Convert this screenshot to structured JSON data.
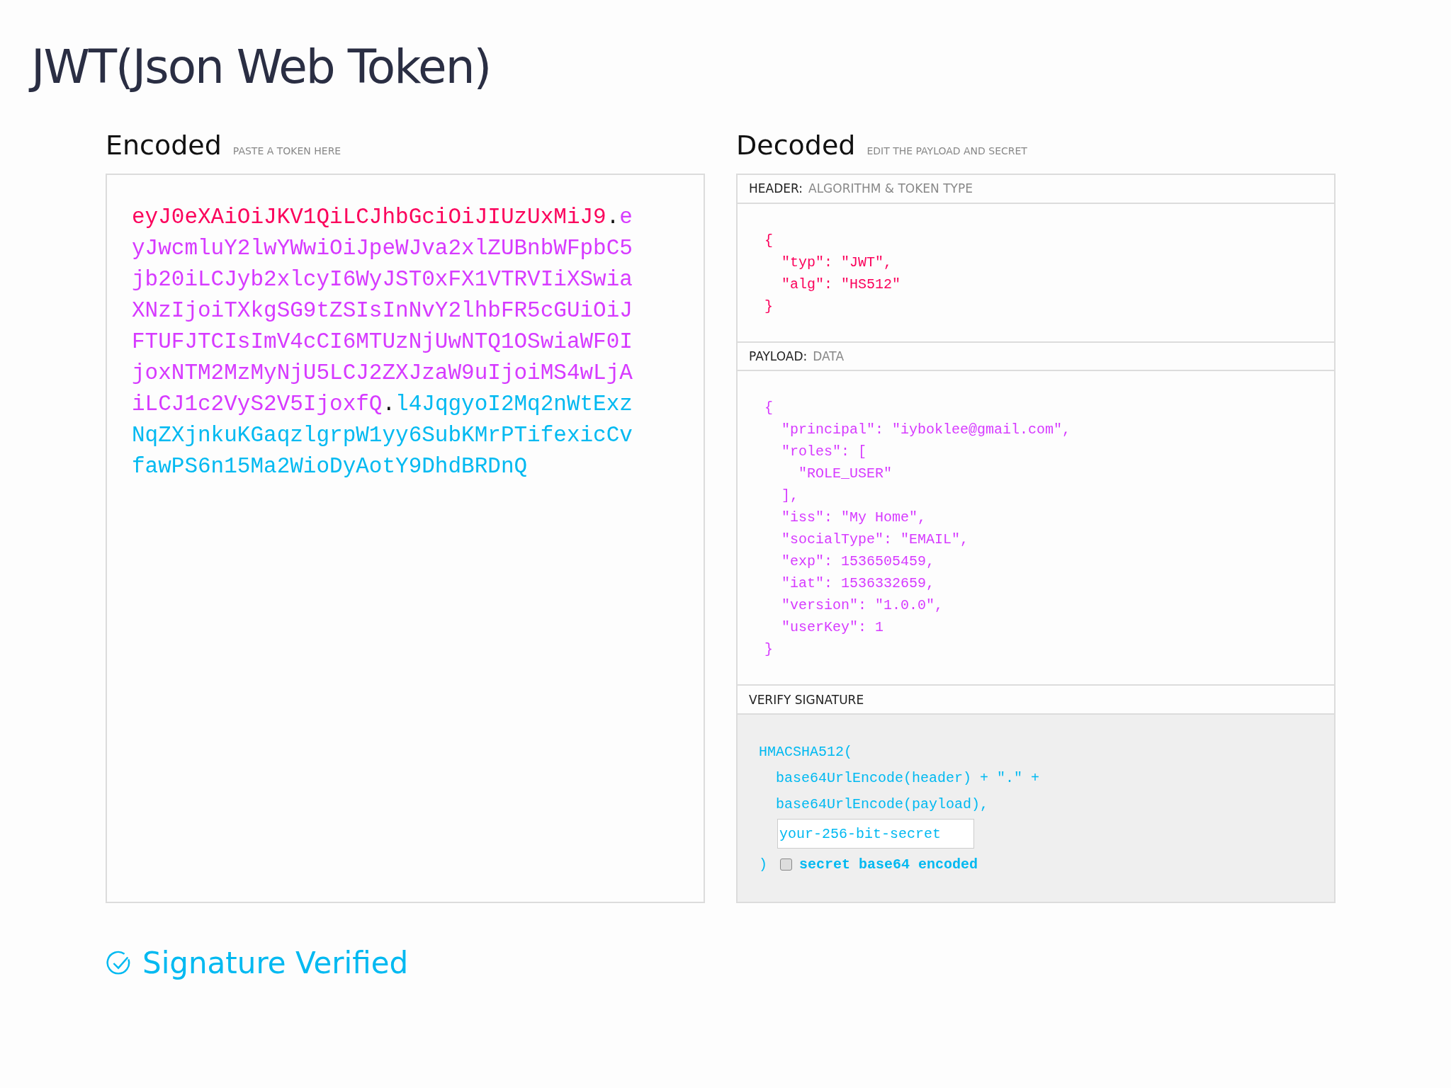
{
  "page_title": "JWT(Json Web Token)",
  "encoded": {
    "heading": "Encoded",
    "hint": "PASTE A TOKEN HERE",
    "token": [
      {
        "kind": "header",
        "text": "eyJ0eXAiOiJKV1QiLCJhbGciOiJIUzUxMiJ9"
      },
      {
        "kind": "dot",
        "text": "."
      },
      {
        "kind": "payload",
        "text": "eyJwcmluY2lwYWwiOiJpeWJva2xlZUBnbWFpbC5jb20iLCJyb2xlcyI6WyJST0xFX1VTRVIiXSwiaXNzIjoiTXkgSG9tZSIsInNvY2lhbFR5cGUiOiJFTUFJTCIsImV4cCI6MTUzNjUwNTQ1OSwiaWF0IjoxNTM2MzMyNjU5LCJ2ZXJzaW9uIjoiMS4wLjAiLCJ1c2VyS2V5IjoxfQ"
      },
      {
        "kind": "dot",
        "text": "."
      },
      {
        "kind": "signature",
        "text": "l4JqgyoI2Mq2nWtExzNqZXjnkuKGaqzlgrpW1yy6SubKMrPTifexicCvfawPS6n15Ma2WioDyAotY9DhdBRDnQ"
      }
    ]
  },
  "decoded": {
    "heading": "Decoded",
    "hint": "EDIT THE PAYLOAD AND SECRET",
    "sections": [
      {
        "kind": "header",
        "label": "HEADER:",
        "sublabel": "ALGORITHM & TOKEN TYPE",
        "lines": [
          "{",
          "  \"typ\": \"JWT\",",
          "  \"alg\": \"HS512\"",
          "}"
        ]
      },
      {
        "kind": "payload",
        "label": "PAYLOAD:",
        "sublabel": "DATA",
        "lines": [
          "{",
          "  \"principal\": \"iyboklee@gmail.com\",",
          "  \"roles\": [",
          "    \"ROLE_USER\"",
          "  ],",
          "  \"iss\": \"My Home\",",
          "  \"socialType\": \"EMAIL\",",
          "  \"exp\": 1536505459,",
          "  \"iat\": 1536332659,",
          "  \"version\": \"1.0.0\",",
          "  \"userKey\": 1",
          "}"
        ]
      }
    ],
    "verify": {
      "label": "VERIFY SIGNATURE",
      "lines": [
        "HMACSHA512(",
        "  base64UrlEncode(header) + \".\" +",
        "  base64UrlEncode(payload),"
      ],
      "secret_placeholder": "your-256-bit-secret",
      "close": ")",
      "checkbox_label": "secret base64 encoded",
      "checked": false
    }
  },
  "status": "Signature Verified"
}
